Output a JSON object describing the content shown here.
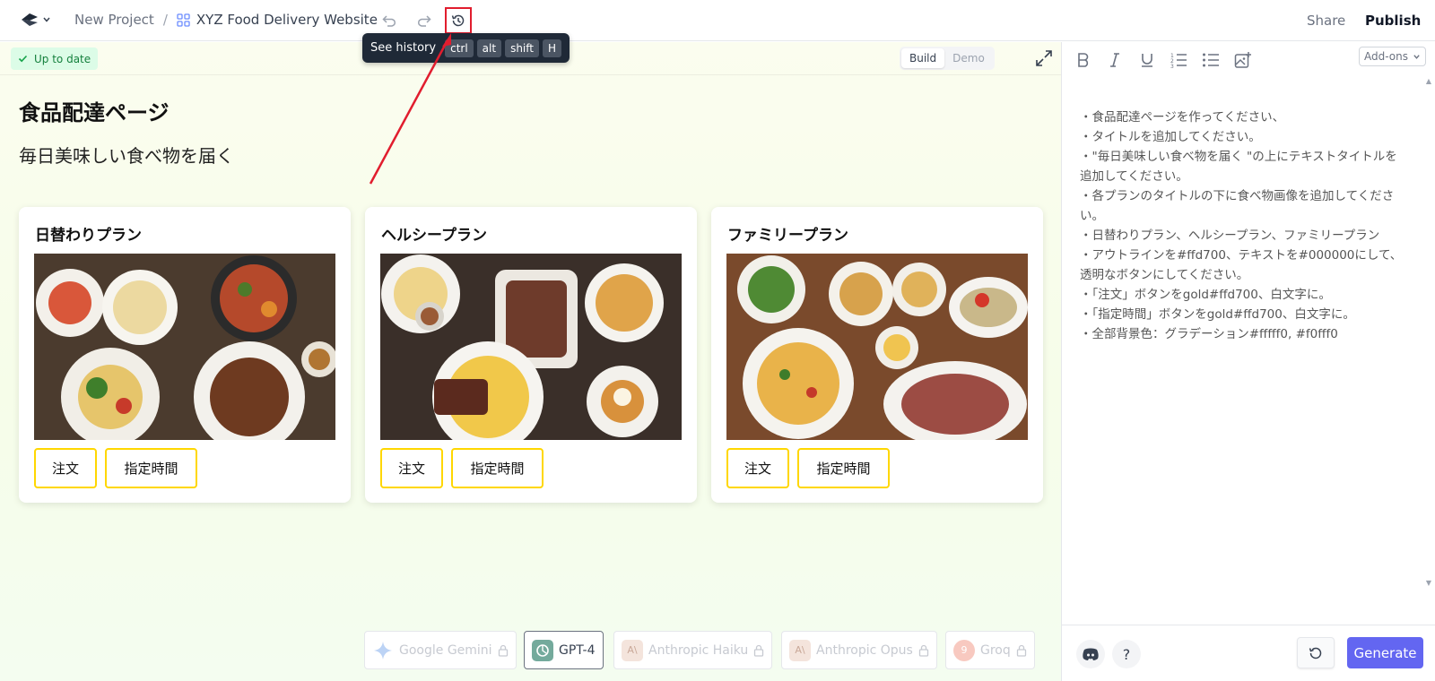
{
  "header": {
    "project_root": "New Project",
    "separator": "/",
    "project_name": "XYZ Food Delivery Website",
    "share_label": "Share",
    "publish_label": "Publish"
  },
  "tooltip": {
    "label": "See history",
    "keys": [
      "ctrl",
      "alt",
      "shift",
      "H"
    ]
  },
  "preview": {
    "status": "Up to date",
    "modes": [
      "Build",
      "Demo"
    ],
    "active_mode": "Build",
    "title": "食品配達ページ",
    "subtitle": "毎日美味しい食べ物を届く",
    "cards": [
      {
        "title": "日替わりプラン",
        "order_label": "注文",
        "time_label": "指定時間"
      },
      {
        "title": "ヘルシープラン",
        "order_label": "注文",
        "time_label": "指定時間"
      },
      {
        "title": "ファミリープラン",
        "order_label": "注文",
        "time_label": "指定時間"
      }
    ]
  },
  "models": [
    {
      "name": "Google Gemini",
      "active": false,
      "locked": true,
      "icon": "gemini-icon"
    },
    {
      "name": "GPT-4",
      "active": true,
      "locked": false,
      "icon": "openai-icon"
    },
    {
      "name": "Anthropic Haiku",
      "active": false,
      "locked": true,
      "icon": "anthropic-icon"
    },
    {
      "name": "Anthropic Opus",
      "active": false,
      "locked": true,
      "icon": "anthropic-icon"
    },
    {
      "name": "Groq",
      "active": false,
      "locked": true,
      "icon": "groq-icon"
    }
  ],
  "editor": {
    "addons_label": "Add-ons",
    "prompt_lines": [
      "・食品配達ページを作ってください、",
      "・タイトルを追加してください。",
      "・\"毎日美味しい食べ物を届く \"の上にテキストタイトルを追加してください。",
      "・各プランのタイトルの下に食べ物画像を追加してください。",
      "・日替わりプラン、ヘルシープラン、ファミリープラン",
      "・アウトラインを#ffd700、テキストを#000000にして、透明なボタンにしてください。",
      "・「注文」ボタンをgold#ffd700、白文字に。",
      "・「指定時間」ボタンをgold#ffd700、白文字に。",
      "・全部背景色：グラデーション#fffff0, #f0fff0"
    ],
    "help_label": "?",
    "generate_label": "Generate"
  },
  "colors": {
    "accent_gold": "#ffd700",
    "generate": "#6366f1",
    "status_bg": "#dcfce7",
    "highlight": "#e11d2e"
  }
}
